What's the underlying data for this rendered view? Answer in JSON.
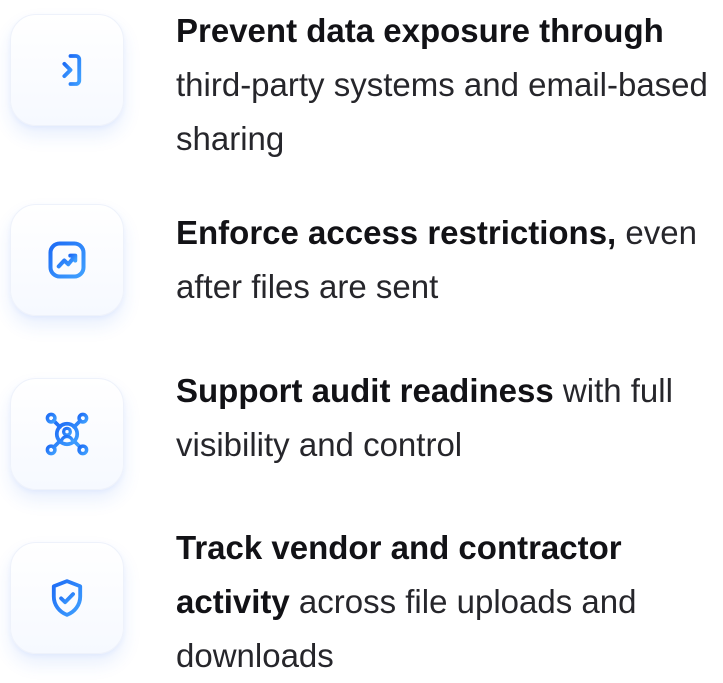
{
  "features": [
    {
      "icon": "arrow-into-bracket-icon",
      "bold": "Prevent data exposure through",
      "rest": " third-party systems and email-based sharing"
    },
    {
      "icon": "trending-chart-icon",
      "bold": "Enforce access restrictions,",
      "rest": " even after files are sent"
    },
    {
      "icon": "user-network-icon",
      "bold": "Support audit readiness",
      "rest": " with full visibility and control"
    },
    {
      "icon": "shield-check-icon",
      "bold": "Track vendor and contractor activity",
      "rest": " across file uploads and downloads"
    }
  ],
  "colors": {
    "icon_gradient_start": "#1e6cf5",
    "icon_gradient_end": "#3fa0ff",
    "text": "#1b1b1f"
  }
}
